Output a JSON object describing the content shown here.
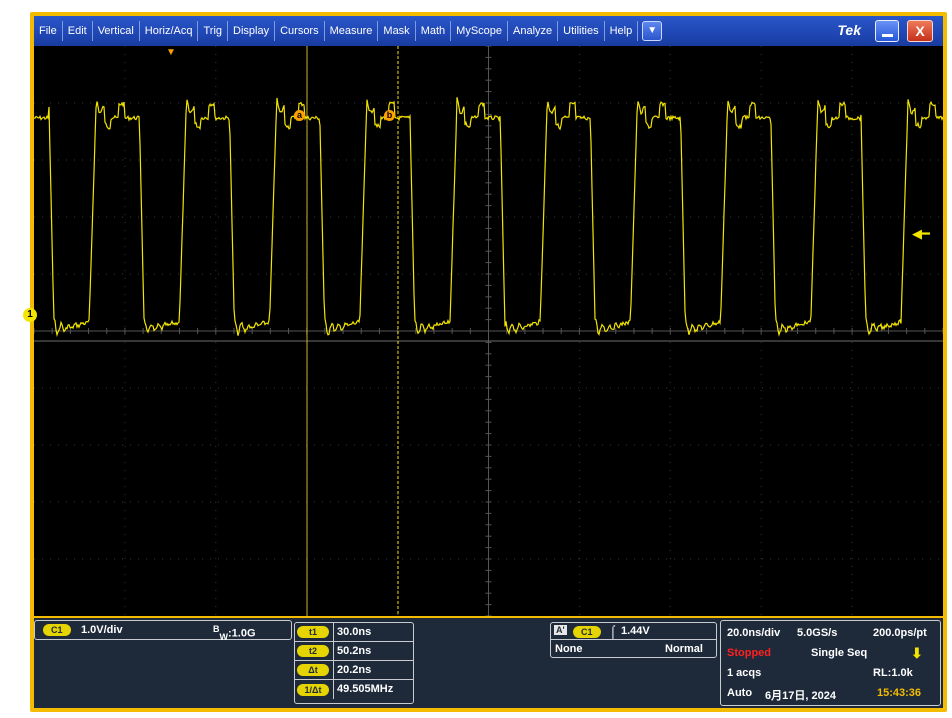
{
  "menubar": {
    "items": [
      "File",
      "Edit",
      "Vertical",
      "Horiz/Acq",
      "Trig",
      "Display",
      "Cursors",
      "Measure",
      "Mask",
      "Math",
      "MyScope",
      "Analyze",
      "Utilities",
      "Help"
    ],
    "dropdown_icon": "down-triangle-icon",
    "logo": "Tek",
    "minimize_icon": "minimize-icon",
    "close_label": "X"
  },
  "colors": {
    "frame": "#f4bc00",
    "menubar": "#1f46b4",
    "screen": "#000000",
    "trace": "#f3e500",
    "cursor": "#ffa000",
    "panel": "#1e2a3a"
  },
  "screen": {
    "channel_marker": "1",
    "cursor_a_label": "a",
    "cursor_b_label": "b"
  },
  "ch1": {
    "badge": "C1",
    "scale": "1.0V/div",
    "bw_prefix": "B",
    "bw_sub": "W",
    "bw_value": ":1.0G"
  },
  "cursors": {
    "rows": [
      {
        "label": "t1",
        "value": "30.0ns"
      },
      {
        "label": "t2",
        "value": "50.2ns"
      },
      {
        "label": "Δt",
        "value": "20.2ns"
      },
      {
        "label": "1/Δt",
        "value": "49.505MHz"
      }
    ]
  },
  "trigger": {
    "mode_badge": "A'",
    "source_badge": "C1",
    "slope_icon": "rising-edge-icon",
    "level": "1.44V",
    "coupling": "None",
    "type": "Normal"
  },
  "horizontal": {
    "scale": "20.0ns/div",
    "sample_rate": "5.0GS/s",
    "resolution": "200.0ps/pt",
    "state": "Stopped",
    "mode": "Single Seq",
    "acqs": "1 acqs",
    "record_length": "RL:1.0k",
    "trigger_mode": "Auto",
    "date": "6月17日, 2024",
    "time": "15:43:36"
  }
}
